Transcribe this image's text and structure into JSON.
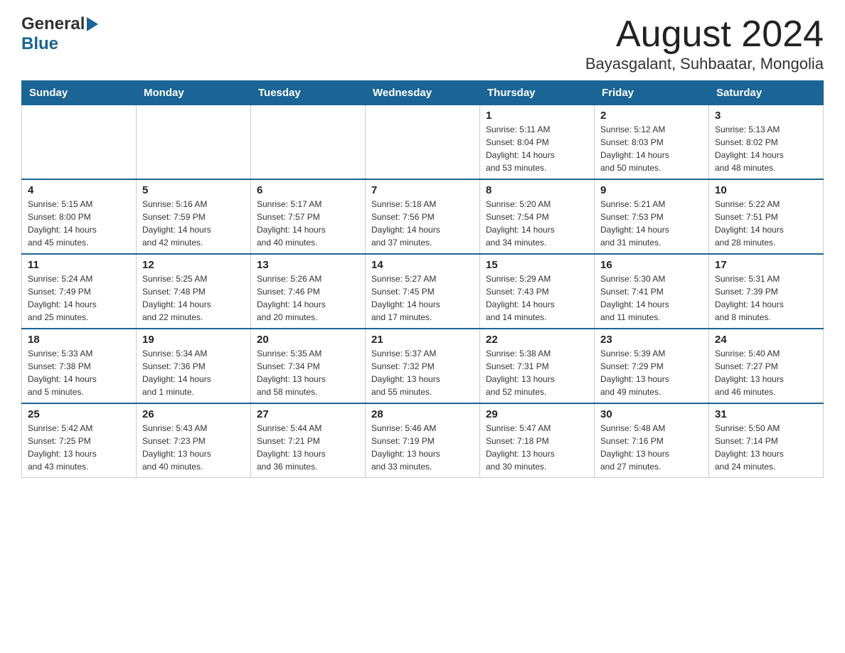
{
  "header": {
    "logo_general": "General",
    "logo_blue": "Blue",
    "month_title": "August 2024",
    "location": "Bayasgalant, Suhbaatar, Mongolia"
  },
  "weekdays": [
    "Sunday",
    "Monday",
    "Tuesday",
    "Wednesday",
    "Thursday",
    "Friday",
    "Saturday"
  ],
  "weeks": [
    [
      {
        "day": "",
        "info": ""
      },
      {
        "day": "",
        "info": ""
      },
      {
        "day": "",
        "info": ""
      },
      {
        "day": "",
        "info": ""
      },
      {
        "day": "1",
        "info": "Sunrise: 5:11 AM\nSunset: 8:04 PM\nDaylight: 14 hours\nand 53 minutes."
      },
      {
        "day": "2",
        "info": "Sunrise: 5:12 AM\nSunset: 8:03 PM\nDaylight: 14 hours\nand 50 minutes."
      },
      {
        "day": "3",
        "info": "Sunrise: 5:13 AM\nSunset: 8:02 PM\nDaylight: 14 hours\nand 48 minutes."
      }
    ],
    [
      {
        "day": "4",
        "info": "Sunrise: 5:15 AM\nSunset: 8:00 PM\nDaylight: 14 hours\nand 45 minutes."
      },
      {
        "day": "5",
        "info": "Sunrise: 5:16 AM\nSunset: 7:59 PM\nDaylight: 14 hours\nand 42 minutes."
      },
      {
        "day": "6",
        "info": "Sunrise: 5:17 AM\nSunset: 7:57 PM\nDaylight: 14 hours\nand 40 minutes."
      },
      {
        "day": "7",
        "info": "Sunrise: 5:18 AM\nSunset: 7:56 PM\nDaylight: 14 hours\nand 37 minutes."
      },
      {
        "day": "8",
        "info": "Sunrise: 5:20 AM\nSunset: 7:54 PM\nDaylight: 14 hours\nand 34 minutes."
      },
      {
        "day": "9",
        "info": "Sunrise: 5:21 AM\nSunset: 7:53 PM\nDaylight: 14 hours\nand 31 minutes."
      },
      {
        "day": "10",
        "info": "Sunrise: 5:22 AM\nSunset: 7:51 PM\nDaylight: 14 hours\nand 28 minutes."
      }
    ],
    [
      {
        "day": "11",
        "info": "Sunrise: 5:24 AM\nSunset: 7:49 PM\nDaylight: 14 hours\nand 25 minutes."
      },
      {
        "day": "12",
        "info": "Sunrise: 5:25 AM\nSunset: 7:48 PM\nDaylight: 14 hours\nand 22 minutes."
      },
      {
        "day": "13",
        "info": "Sunrise: 5:26 AM\nSunset: 7:46 PM\nDaylight: 14 hours\nand 20 minutes."
      },
      {
        "day": "14",
        "info": "Sunrise: 5:27 AM\nSunset: 7:45 PM\nDaylight: 14 hours\nand 17 minutes."
      },
      {
        "day": "15",
        "info": "Sunrise: 5:29 AM\nSunset: 7:43 PM\nDaylight: 14 hours\nand 14 minutes."
      },
      {
        "day": "16",
        "info": "Sunrise: 5:30 AM\nSunset: 7:41 PM\nDaylight: 14 hours\nand 11 minutes."
      },
      {
        "day": "17",
        "info": "Sunrise: 5:31 AM\nSunset: 7:39 PM\nDaylight: 14 hours\nand 8 minutes."
      }
    ],
    [
      {
        "day": "18",
        "info": "Sunrise: 5:33 AM\nSunset: 7:38 PM\nDaylight: 14 hours\nand 5 minutes."
      },
      {
        "day": "19",
        "info": "Sunrise: 5:34 AM\nSunset: 7:36 PM\nDaylight: 14 hours\nand 1 minute."
      },
      {
        "day": "20",
        "info": "Sunrise: 5:35 AM\nSunset: 7:34 PM\nDaylight: 13 hours\nand 58 minutes."
      },
      {
        "day": "21",
        "info": "Sunrise: 5:37 AM\nSunset: 7:32 PM\nDaylight: 13 hours\nand 55 minutes."
      },
      {
        "day": "22",
        "info": "Sunrise: 5:38 AM\nSunset: 7:31 PM\nDaylight: 13 hours\nand 52 minutes."
      },
      {
        "day": "23",
        "info": "Sunrise: 5:39 AM\nSunset: 7:29 PM\nDaylight: 13 hours\nand 49 minutes."
      },
      {
        "day": "24",
        "info": "Sunrise: 5:40 AM\nSunset: 7:27 PM\nDaylight: 13 hours\nand 46 minutes."
      }
    ],
    [
      {
        "day": "25",
        "info": "Sunrise: 5:42 AM\nSunset: 7:25 PM\nDaylight: 13 hours\nand 43 minutes."
      },
      {
        "day": "26",
        "info": "Sunrise: 5:43 AM\nSunset: 7:23 PM\nDaylight: 13 hours\nand 40 minutes."
      },
      {
        "day": "27",
        "info": "Sunrise: 5:44 AM\nSunset: 7:21 PM\nDaylight: 13 hours\nand 36 minutes."
      },
      {
        "day": "28",
        "info": "Sunrise: 5:46 AM\nSunset: 7:19 PM\nDaylight: 13 hours\nand 33 minutes."
      },
      {
        "day": "29",
        "info": "Sunrise: 5:47 AM\nSunset: 7:18 PM\nDaylight: 13 hours\nand 30 minutes."
      },
      {
        "day": "30",
        "info": "Sunrise: 5:48 AM\nSunset: 7:16 PM\nDaylight: 13 hours\nand 27 minutes."
      },
      {
        "day": "31",
        "info": "Sunrise: 5:50 AM\nSunset: 7:14 PM\nDaylight: 13 hours\nand 24 minutes."
      }
    ]
  ]
}
